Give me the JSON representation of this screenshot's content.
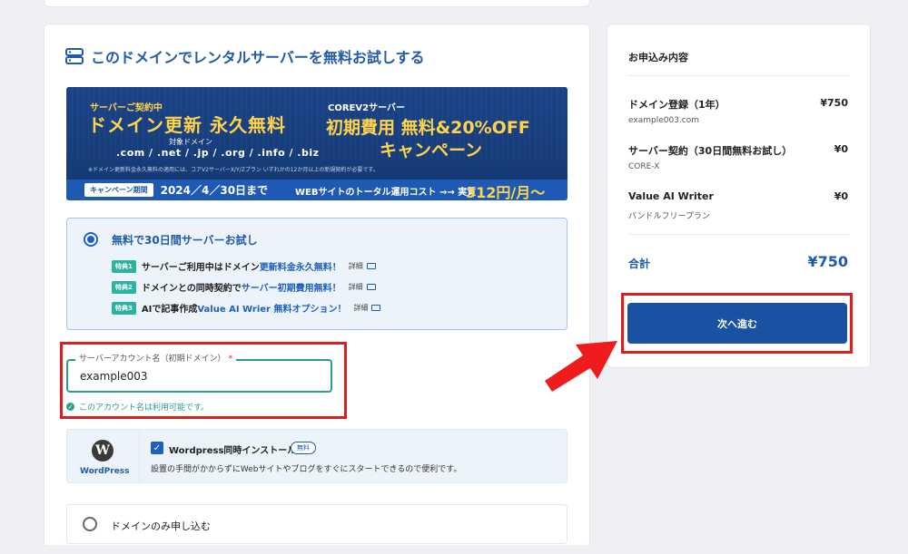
{
  "section": {
    "title": "このドメインでレンタルサーバーを無料お試しする"
  },
  "banner": {
    "left_sub": "サーバーご契約中",
    "left_main": "ドメイン更新 永久無料",
    "left_target": "対象ドメイン",
    "left_tlds": ".com / .net / .jp / .org / .info / .biz",
    "right_sub": "COREV2サーバー",
    "right_main1": "初期費用 無料&20%OFF",
    "right_main2": "キャンペーン",
    "note": "※ドメイン更新料金永久無料の適用には、コアV2サーバーX/Y/Zプラン いずれかの12か月以上の新規契約が必要です。",
    "campaign_tag": "キャンペーン期間",
    "campaign_date": "2024／4／30日まで",
    "cost_text": "WEBサイトのトータル運用コスト →→ 実質",
    "cost_price": "312円/月〜"
  },
  "trial": {
    "title": "無料で30日間サーバーお試し",
    "perks": [
      {
        "tag": "特典1",
        "text_before": "サーバーご利用中はドメイン",
        "highlight": "更新料金永久無料！",
        "text_after": "",
        "detail": "詳細"
      },
      {
        "tag": "特典2",
        "text_before": "ドメインとの同時契約で",
        "highlight": "サーバー初期費用無料！",
        "text_after": "",
        "detail": "詳細"
      },
      {
        "tag": "特典3",
        "text_before": "AIで記事作成 ",
        "highlight": "Value AI Wrier 無料オプション！",
        "text_after": "",
        "detail": "詳細"
      }
    ]
  },
  "account_field": {
    "label": "サーバーアカウント名（初期ドメイン）",
    "required_mark": "*",
    "value": "example003",
    "valid_message": "このアカウント名は利用可能です。"
  },
  "wordpress": {
    "logo_text": "WordPress",
    "title": "Wordpress同時インストール",
    "badge": "無料",
    "description": "設置の手間がかからずにWebサイトやブログをすぐにスタートできるので便利です。"
  },
  "domain_only": {
    "label": "ドメインのみ申し込む"
  },
  "order": {
    "title": "お申込み内容",
    "items": [
      {
        "name": "ドメイン登録（1年）",
        "sub": "example003.com",
        "price": "¥750"
      },
      {
        "name": "サーバー契約（30日間無料お試し）",
        "sub": "CORE-X",
        "price": "¥0"
      },
      {
        "name": "Value AI Writer",
        "sub": "バンドルフリープラン",
        "price": "¥0"
      }
    ],
    "total_label": "合計",
    "total_price": "¥750",
    "next_button": "次へ進む"
  },
  "colors": {
    "brand_blue": "#1f5ba8",
    "button_blue": "#1a52a3",
    "highlight_red": "#e31b1b",
    "success_teal": "#2a9d8f"
  }
}
